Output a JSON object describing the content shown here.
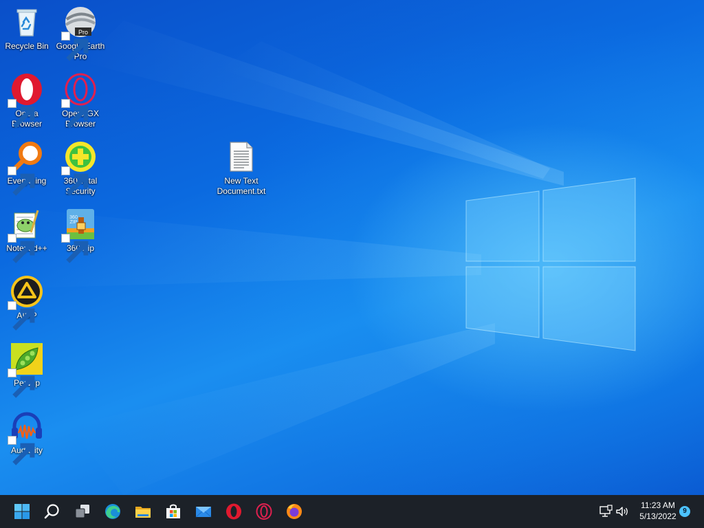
{
  "desktop": {
    "icons": [
      {
        "label": "Recycle Bin",
        "icon": "recycle-bin-icon",
        "shortcut": false
      },
      {
        "label": "Google Earth Pro",
        "badge": "Pro",
        "icon": "google-earth-icon",
        "shortcut": true
      },
      {
        "label": "Opera Browser",
        "icon": "opera-icon",
        "shortcut": true
      },
      {
        "label": "Opera GX Browser",
        "icon": "opera-gx-icon",
        "shortcut": true
      },
      {
        "label": "Everything",
        "icon": "everything-search-icon",
        "shortcut": true
      },
      {
        "label": "360 Total Security",
        "icon": "360-total-security-icon",
        "shortcut": true
      },
      {
        "label": "Notepad++",
        "icon": "notepad-plus-plus-icon",
        "shortcut": true
      },
      {
        "label": "360 Zip",
        "badge": "360 ZIP",
        "icon": "360-zip-icon",
        "shortcut": true
      },
      {
        "label": "AIMP",
        "icon": "aimp-icon",
        "shortcut": true
      },
      {
        "label": "PeaZip",
        "icon": "peazip-icon",
        "shortcut": true
      },
      {
        "label": "Audacity",
        "icon": "audacity-icon",
        "shortcut": true
      },
      {
        "label": "New Text Document.txt",
        "icon": "text-document-icon",
        "shortcut": false
      }
    ]
  },
  "taskbar": {
    "pinned": [
      {
        "name": "start-button",
        "icon": "windows-logo-icon"
      },
      {
        "name": "search-button",
        "icon": "search-icon"
      },
      {
        "name": "task-view-button",
        "icon": "task-view-icon"
      },
      {
        "name": "edge-taskbar-button",
        "icon": "edge-icon"
      },
      {
        "name": "file-explorer-taskbar-button",
        "icon": "folder-icon"
      },
      {
        "name": "store-taskbar-button",
        "icon": "store-icon"
      },
      {
        "name": "mail-taskbar-button",
        "icon": "mail-icon"
      },
      {
        "name": "opera-taskbar-button",
        "icon": "opera-icon"
      },
      {
        "name": "opera-gx-taskbar-button",
        "icon": "opera-gx-icon"
      },
      {
        "name": "firefox-taskbar-button",
        "icon": "firefox-icon"
      }
    ],
    "tray": {
      "network_icon": "network-icon",
      "volume_icon": "volume-icon",
      "time": "11:23 AM",
      "date": "5/13/2022",
      "notification_count": "9"
    }
  },
  "colors": {
    "taskbar": "#1c2128",
    "desktop_blue": "#0b6ae0",
    "accent": "#4cc2ff"
  }
}
